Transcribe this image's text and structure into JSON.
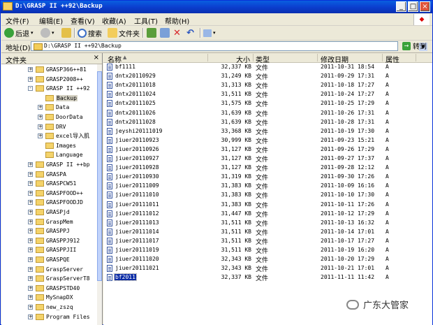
{
  "window": {
    "title": "D:\\GRASP II ++92\\Backup",
    "controls": [
      "_",
      "□",
      "×"
    ]
  },
  "menu": [
    {
      "label": "文件(F)"
    },
    {
      "label": "编辑(E)"
    },
    {
      "label": "查看(V)"
    },
    {
      "label": "收藏(A)"
    },
    {
      "label": "工具(T)"
    },
    {
      "label": "帮助(H)"
    }
  ],
  "toolbar": {
    "back_label": "后退",
    "search_label": "搜索",
    "folders_label": "文件夹"
  },
  "address": {
    "label": "地址(D)",
    "value": "D:\\GRASP II ++92\\Backup",
    "go_label": "转到"
  },
  "folder_pane": {
    "title": "文件夹",
    "close": "×",
    "items": [
      {
        "label": "GRASP366++81",
        "expander": "+",
        "indent": 0
      },
      {
        "label": "GRASP2008++",
        "expander": "+",
        "indent": 0
      },
      {
        "label": "GRASP II ++92",
        "expander": "-",
        "indent": 0
      },
      {
        "label": "Backup",
        "expander": "",
        "indent": 1,
        "selected": true
      },
      {
        "label": "Data",
        "expander": "+",
        "indent": 1
      },
      {
        "label": "DoorData",
        "expander": "+",
        "indent": 1
      },
      {
        "label": "DRV",
        "expander": "+",
        "indent": 1
      },
      {
        "label": "excel导入肌",
        "expander": "+",
        "indent": 1
      },
      {
        "label": "Images",
        "expander": "",
        "indent": 1
      },
      {
        "label": "Language",
        "expander": "",
        "indent": 1
      },
      {
        "label": "GRASP II ++bp",
        "expander": "+",
        "indent": 0
      },
      {
        "label": "GRASPA",
        "expander": "+",
        "indent": 0
      },
      {
        "label": "GRASPCW51",
        "expander": "+",
        "indent": 0
      },
      {
        "label": "GRASPFOOD++",
        "expander": "+",
        "indent": 0
      },
      {
        "label": "GRASPFOODJD",
        "expander": "+",
        "indent": 0
      },
      {
        "label": "GRASPjd",
        "expander": "+",
        "indent": 0
      },
      {
        "label": "GraspMem",
        "expander": "+",
        "indent": 0
      },
      {
        "label": "GRASPPJ",
        "expander": "+",
        "indent": 0
      },
      {
        "label": "GRASPPJ912",
        "expander": "+",
        "indent": 0
      },
      {
        "label": "GRASPPJII",
        "expander": "+",
        "indent": 0
      },
      {
        "label": "GRASPQE",
        "expander": "+",
        "indent": 0
      },
      {
        "label": "GraspServer",
        "expander": "+",
        "indent": 0
      },
      {
        "label": "GraspServerT8",
        "expander": "+",
        "indent": 0
      },
      {
        "label": "GRASPSTD40",
        "expander": "+",
        "indent": 0
      },
      {
        "label": "MySnapDX",
        "expander": "+",
        "indent": 0
      },
      {
        "label": "new_zszq",
        "expander": "+",
        "indent": 0
      },
      {
        "label": "Program Files",
        "expander": "+",
        "indent": 0
      }
    ]
  },
  "file_list": {
    "columns": {
      "name": "名称",
      "size": "大小",
      "type": "类型",
      "date": "修改日期",
      "attr": "属性"
    },
    "rows": [
      {
        "name": "bf1111",
        "size": "32,337 KB",
        "type": "文件",
        "date": "2011-10-31 18:54",
        "attr": "A"
      },
      {
        "name": "dntx20110929",
        "size": "31,249 KB",
        "type": "文件",
        "date": "2011-09-29 17:31",
        "attr": "A"
      },
      {
        "name": "dntx20111018",
        "size": "31,313 KB",
        "type": "文件",
        "date": "2011-10-18 17:27",
        "attr": "A"
      },
      {
        "name": "dntx20111024",
        "size": "31,511 KB",
        "type": "文件",
        "date": "2011-10-24 17:27",
        "attr": "A"
      },
      {
        "name": "dntx20111025",
        "size": "31,575 KB",
        "type": "文件",
        "date": "2011-10-25 17:29",
        "attr": "A"
      },
      {
        "name": "dntx20111026",
        "size": "31,639 KB",
        "type": "文件",
        "date": "2011-10-26 17:31",
        "attr": "A"
      },
      {
        "name": "dntx20111028",
        "size": "31,639 KB",
        "type": "文件",
        "date": "2011-10-28 17:31",
        "attr": "A"
      },
      {
        "name": "jeyshi20111019",
        "size": "33,368 KB",
        "type": "文件",
        "date": "2011-10-19 17:30",
        "attr": "A"
      },
      {
        "name": "jiuer20110923",
        "size": "30,999 KB",
        "type": "文件",
        "date": "2011-09-23 15:21",
        "attr": "A"
      },
      {
        "name": "jiuer20110926",
        "size": "31,127 KB",
        "type": "文件",
        "date": "2011-09-26 17:29",
        "attr": "A"
      },
      {
        "name": "jiuer20110927",
        "size": "31,127 KB",
        "type": "文件",
        "date": "2011-09-27 17:37",
        "attr": "A"
      },
      {
        "name": "jiuer20110928",
        "size": "31,127 KB",
        "type": "文件",
        "date": "2011-09-28 12:12",
        "attr": "A"
      },
      {
        "name": "jiuer20110930",
        "size": "31,319 KB",
        "type": "文件",
        "date": "2011-09-30 17:26",
        "attr": "A"
      },
      {
        "name": "jiuer20111009",
        "size": "31,383 KB",
        "type": "文件",
        "date": "2011-10-09 16:16",
        "attr": "A"
      },
      {
        "name": "jiuer20111010",
        "size": "31,383 KB",
        "type": "文件",
        "date": "2011-10-10 17:30",
        "attr": "A"
      },
      {
        "name": "jiuer20111011",
        "size": "31,383 KB",
        "type": "文件",
        "date": "2011-10-11 17:26",
        "attr": "A"
      },
      {
        "name": "jiuer20111012",
        "size": "31,447 KB",
        "type": "文件",
        "date": "2011-10-12 17:29",
        "attr": "A"
      },
      {
        "name": "jiuer20111013",
        "size": "31,511 KB",
        "type": "文件",
        "date": "2011-10-13 16:32",
        "attr": "A"
      },
      {
        "name": "jiuer20111014",
        "size": "31,511 KB",
        "type": "文件",
        "date": "2011-10-14 17:01",
        "attr": "A"
      },
      {
        "name": "jiuer20111017",
        "size": "31,511 KB",
        "type": "文件",
        "date": "2011-10-17 17:27",
        "attr": "A"
      },
      {
        "name": "jiuer20111019",
        "size": "31,511 KB",
        "type": "文件",
        "date": "2011-10-19 16:20",
        "attr": "A"
      },
      {
        "name": "jiuer20111020",
        "size": "32,343 KB",
        "type": "文件",
        "date": "2011-10-20 17:29",
        "attr": "A"
      },
      {
        "name": "jiuer20111021",
        "size": "32,343 KB",
        "type": "文件",
        "date": "2011-10-21 17:01",
        "attr": "A"
      },
      {
        "name": "bf2011",
        "size": "32,337 KB",
        "type": "文件",
        "date": "2011-11-11 11:42",
        "attr": "A",
        "selected": true
      }
    ]
  },
  "watermark": {
    "text": "广东大管家"
  }
}
